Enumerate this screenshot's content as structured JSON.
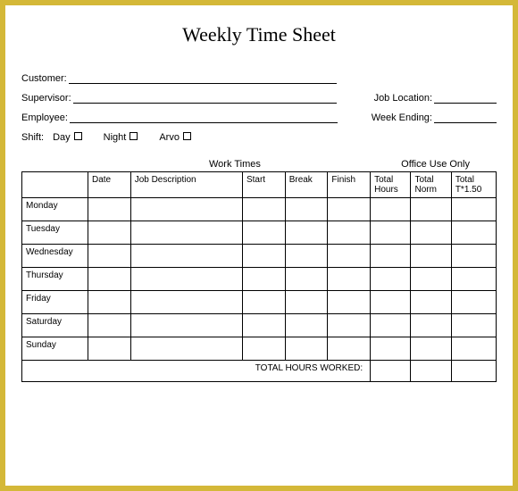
{
  "title": "Weekly Time Sheet",
  "fields": {
    "customer": "Customer:",
    "supervisor": "Supervisor:",
    "employee": "Employee:",
    "job_location": "Job Location:",
    "week_ending": "Week Ending:"
  },
  "shift": {
    "label": "Shift:",
    "day": "Day",
    "night": "Night",
    "arvo": "Arvo"
  },
  "sections": {
    "work_times": "Work Times",
    "office_use": "Office Use Only"
  },
  "headers": {
    "date": "Date",
    "job_description": "Job Description",
    "start": "Start",
    "break": "Break",
    "finish": "Finish",
    "total_hours": "Total Hours",
    "total_norm": "Total Norm",
    "total_t150": "Total T*1.50"
  },
  "days": [
    "Monday",
    "Tuesday",
    "Wednesday",
    "Thursday",
    "Friday",
    "Saturday",
    "Sunday"
  ],
  "total_label": "TOTAL HOURS WORKED:"
}
